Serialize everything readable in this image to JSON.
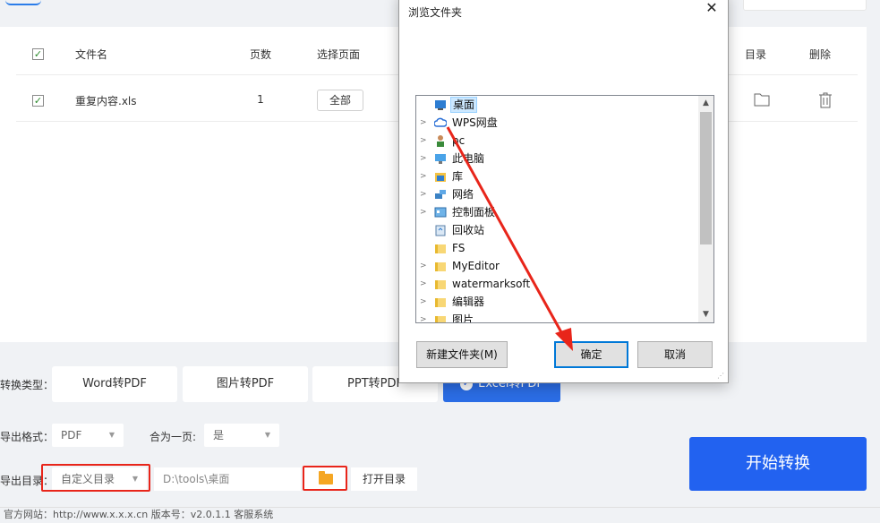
{
  "table": {
    "header": {
      "name": "文件名",
      "pages": "页数",
      "select": "选择页面",
      "dir": "目录",
      "delete": "删除"
    },
    "rows": [
      {
        "name": "重复内容.xls",
        "pages": "1",
        "select_btn": "全部"
      }
    ]
  },
  "convert_type": {
    "label": "转换类型：",
    "options": [
      "Word转PDF",
      "图片转PDF",
      "PPT转PDF",
      "Excel转PDF"
    ],
    "active": "Excel转PDF"
  },
  "export_format": {
    "label": "导出格式：",
    "value": "PDF"
  },
  "merge": {
    "label": "合为一页:",
    "value": "是"
  },
  "export_dir": {
    "label": "导出目录：",
    "mode": "自定义目录",
    "path": "D:\\tools\\桌面",
    "open_btn": "打开目录"
  },
  "start_button": "开始转换",
  "footer_text": "官方网站：http://www.x.x.x.cn        版本号：v2.0.1.1        客服系统",
  "dialog": {
    "title": "浏览文件夹",
    "close": "✕",
    "tree": [
      {
        "label": "桌面",
        "icon": "desktop-icon",
        "arrow": ""
      },
      {
        "label": "WPS网盘",
        "icon": "cloud-icon",
        "arrow": ">"
      },
      {
        "label": "pc",
        "icon": "user-icon",
        "arrow": ">"
      },
      {
        "label": "此电脑",
        "icon": "computer-icon",
        "arrow": ">"
      },
      {
        "label": "库",
        "icon": "library-icon",
        "arrow": ">"
      },
      {
        "label": "网络",
        "icon": "network-icon",
        "arrow": ">"
      },
      {
        "label": "控制面板",
        "icon": "control-panel-icon",
        "arrow": ">"
      },
      {
        "label": "回收站",
        "icon": "recycle-bin-icon",
        "arrow": ""
      },
      {
        "label": "FS",
        "icon": "folder-icon",
        "arrow": ""
      },
      {
        "label": "MyEditor",
        "icon": "folder-icon",
        "arrow": ">"
      },
      {
        "label": "watermarksoft",
        "icon": "folder-icon",
        "arrow": ">"
      },
      {
        "label": "编辑器",
        "icon": "folder-icon",
        "arrow": ">"
      },
      {
        "label": "图片",
        "icon": "folder-icon",
        "arrow": ">"
      }
    ],
    "buttons": {
      "new_folder": "新建文件夹(M)",
      "ok": "确定",
      "cancel": "取消"
    }
  },
  "colors": {
    "accent": "#2262f0",
    "annotation_red": "#e8251a",
    "folder": "#f5a623"
  }
}
